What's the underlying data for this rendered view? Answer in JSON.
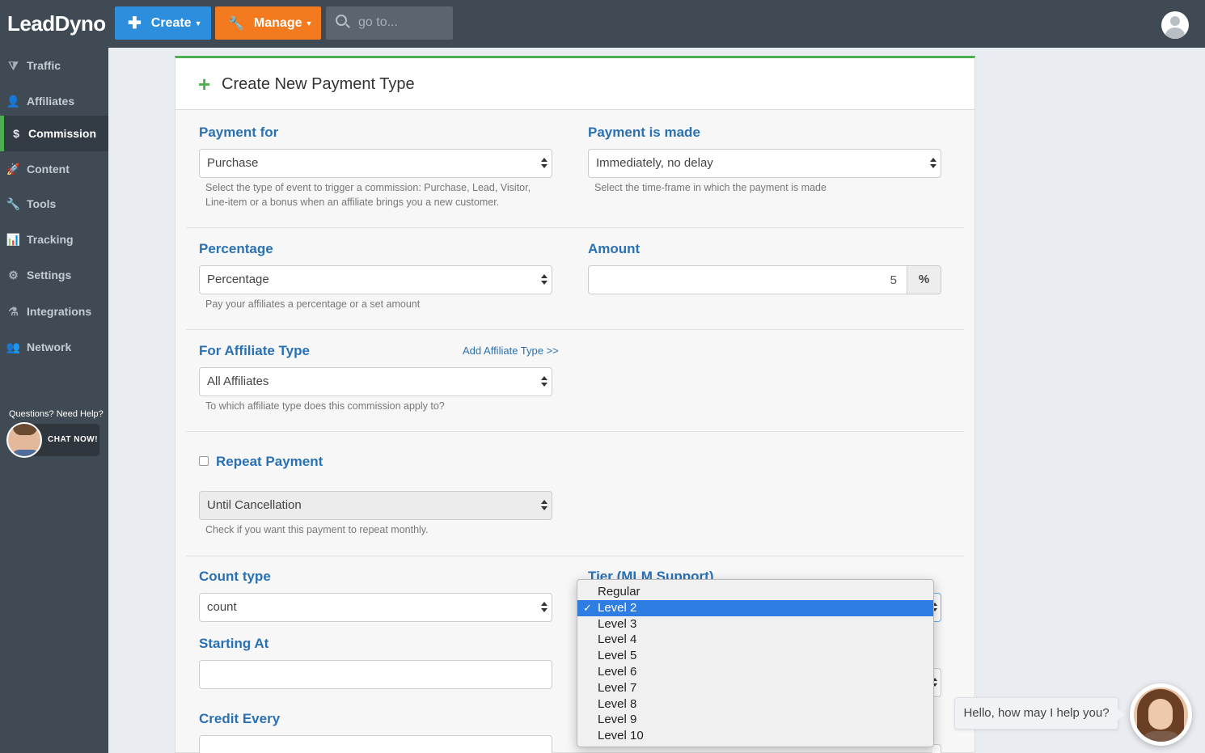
{
  "app": {
    "logo": "LeadDyno"
  },
  "topbar": {
    "create_label": "Create",
    "manage_label": "Manage",
    "search_placeholder": "go to..."
  },
  "sidebar": {
    "items": [
      {
        "label": "Traffic",
        "icon": "filter-icon"
      },
      {
        "label": "Affiliates",
        "icon": "user-icon"
      },
      {
        "label": "Commission",
        "icon": "dollar-icon",
        "active": true
      },
      {
        "label": "Content",
        "icon": "rocket-icon"
      },
      {
        "label": "Tools",
        "icon": "wrench-icon"
      },
      {
        "label": "Tracking",
        "icon": "bar-chart-icon"
      },
      {
        "label": "Settings",
        "icon": "gears-icon"
      },
      {
        "label": "Integrations",
        "icon": "flask-icon"
      },
      {
        "label": "Network",
        "icon": "users-icon"
      }
    ],
    "help_text": "Questions? Need Help?",
    "chat_label": "CHAT NOW!"
  },
  "form": {
    "title": "Create New Payment Type",
    "payment_for": {
      "label": "Payment for",
      "value": "Purchase",
      "hint": "Select the type of event to trigger a commission: Purchase, Lead, Visitor, Line-item or a bonus when an affiliate brings you a new customer."
    },
    "payment_made": {
      "label": "Payment is made",
      "value": "Immediately, no delay",
      "hint": "Select the time-frame in which the payment is made"
    },
    "percentage": {
      "label": "Percentage",
      "value": "Percentage",
      "hint": "Pay your affiliates a percentage or a set amount"
    },
    "amount": {
      "label": "Amount",
      "value": "5",
      "unit": "%"
    },
    "affiliate_type": {
      "label": "For Affiliate Type",
      "link": "Add Affiliate Type >>",
      "value": "All Affiliates",
      "hint": "To which affiliate type does this commission apply to?"
    },
    "repeat": {
      "label": "Repeat Payment",
      "value": "Until Cancellation",
      "hint": "Check if you want this payment to repeat monthly."
    },
    "count_type": {
      "label": "Count type",
      "value": "count"
    },
    "tier": {
      "label": "Tier (MLM Support)"
    },
    "starting_at": {
      "label": "Starting At",
      "value": ""
    },
    "credit_every": {
      "label": "Credit Every"
    }
  },
  "dropdown": {
    "selected_index": 1,
    "options": [
      "Regular",
      "Level 2",
      "Level 3",
      "Level 4",
      "Level 5",
      "Level 6",
      "Level 7",
      "Level 8",
      "Level 9",
      "Level 10"
    ]
  },
  "chat": {
    "message": "Hello, how may I help you?"
  },
  "colors": {
    "accent_green": "#4caf50",
    "create_blue": "#2e8ede",
    "manage_orange": "#f47a1f",
    "label_blue": "#2a71b4",
    "selection_blue": "#2e7de3"
  }
}
